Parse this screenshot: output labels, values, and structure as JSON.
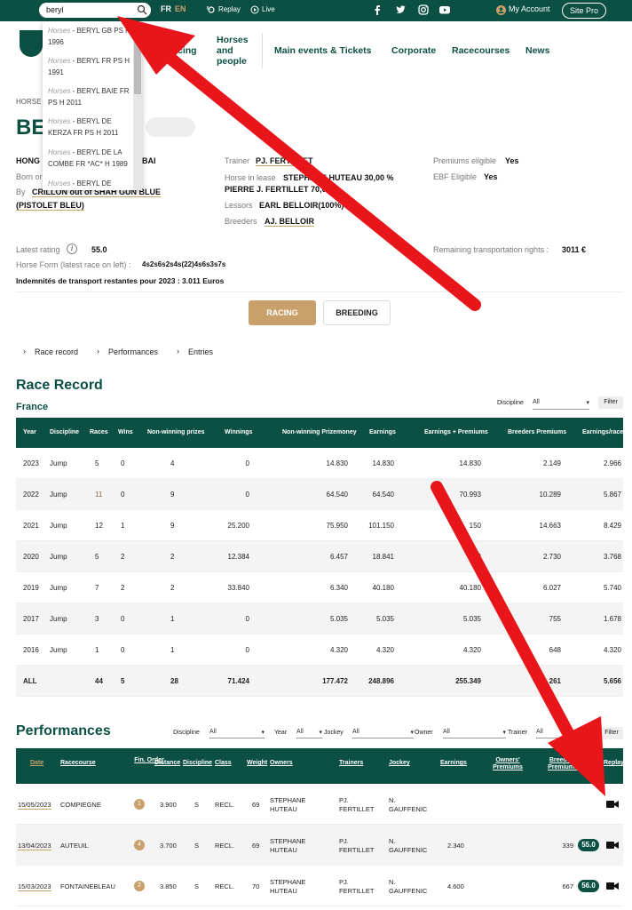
{
  "topbar": {
    "search_value": "beryl",
    "lang_fr": "FR",
    "lang_en": "EN",
    "replay": "Replay",
    "live": "Live",
    "account": "My Account",
    "site_pro": "Site Pro"
  },
  "nav": {
    "racing": "cing",
    "horses_people": [
      "Horses",
      "and",
      "people"
    ],
    "main_events": "Main events & Tickets",
    "corporate": "Corporate",
    "racecourses": "Racecourses",
    "news": "News"
  },
  "dropdown": [
    {
      "prefix": "Horses",
      "text": " - BERYL GB PS H 1996"
    },
    {
      "prefix": "Horses",
      "text": " - BERYL FR PS H 1991"
    },
    {
      "prefix": "Horses",
      "text": " - BERYL BAIE FR PS H 2011"
    },
    {
      "prefix": "Horses",
      "text": " - BERYL DE KERZA FR PS H 2011"
    },
    {
      "prefix": "Horses",
      "text": " - BERYL DE LA COMBE FR *AC* H 1989"
    },
    {
      "prefix": "Horses",
      "text": " - BERYL DE"
    }
  ],
  "horse": {
    "breadcrumb": "HORSE I",
    "name": "BE",
    "origin_partial": "HONG",
    "origin_tail": "BAI",
    "born_partial": "Born or",
    "by_label": "By",
    "sire": "CRILLON out of SHAH GUN BLUE",
    "damsire": "(PISTOLET BLEU)",
    "trainer_label": "Trainer",
    "trainer": "PJ. FERTILLET",
    "lease_label": "Horse in lease",
    "lease_value": "STEPHANE HUTEAU 30,00 %",
    "lease_value2": "PIERRE J. FERTILLET 70,00 %",
    "lessors_label": "Lessors",
    "lessors": "EARL BELLOIR(100%)",
    "breeders_label": "Breeders",
    "breeders": "AJ. BELLOIR",
    "premiums_label": "Premiums eligible",
    "premiums": "Yes",
    "ebf_label": "EBF Eligible",
    "ebf": "Yes",
    "latest_rating_label": "Latest rating",
    "latest_rating": "55.0",
    "form_label": "Horse Form (latest race on left) :",
    "form": "4s2s6s2s4s(22)4s6s3s7s",
    "transport_label": "Remaining transportation rights :",
    "transport": "3011 €",
    "indemnites": "Indemnités de transport restantes pour 2023 : 3.011 Euros"
  },
  "buttons": {
    "racing": "RACING",
    "breeding": "BREEDING"
  },
  "tabs": [
    "Race record",
    "Performances",
    "Entries"
  ],
  "race_record": {
    "title": "Race Record",
    "country": "France",
    "discipline_label": "Discipline",
    "discipline_value": "All",
    "filter": "Filter",
    "headers": [
      "Year",
      "Discipline",
      "Races",
      "Wins",
      "Non-winning prizes",
      "Winnings",
      "Non-winning Prizemoney",
      "Earnings",
      "Earnings + Premiums",
      "Breeders Premiums",
      "Earnings/race"
    ],
    "rows": [
      [
        "2023",
        "Jump",
        "5",
        "0",
        "4",
        "0",
        "14.830",
        "14.830",
        "14.830",
        "2.149",
        "2.966"
      ],
      [
        "2022",
        "Jump",
        "11",
        "0",
        "9",
        "0",
        "64.540",
        "64.540",
        "70.993",
        "10.289",
        "5.867"
      ],
      [
        "2021",
        "Jump",
        "12",
        "1",
        "9",
        "25.200",
        "75.950",
        "101.150",
        "150",
        "14.663",
        "8.429"
      ],
      [
        "2020",
        "Jump",
        "5",
        "2",
        "2",
        "12.384",
        "6.457",
        "18.841",
        "18",
        "2.730",
        "3.768"
      ],
      [
        "2019",
        "Jump",
        "7",
        "2",
        "2",
        "33.840",
        "6.340",
        "40.180",
        "40.180",
        "6.027",
        "5.740"
      ],
      [
        "2017",
        "Jump",
        "3",
        "0",
        "1",
        "0",
        "5.035",
        "5.035",
        "5.035",
        "755",
        "1.678"
      ],
      [
        "2016",
        "Jump",
        "1",
        "0",
        "1",
        "0",
        "4.320",
        "4.320",
        "4.320",
        "648",
        "4.320"
      ],
      [
        "ALL",
        "",
        "44",
        "5",
        "28",
        "71.424",
        "177.472",
        "248.896",
        "255.349",
        "261",
        "5.656"
      ]
    ]
  },
  "performances": {
    "title": "Performances",
    "filters": [
      {
        "label": "Discipline",
        "value": "All"
      },
      {
        "label": "Year",
        "value": "All"
      },
      {
        "label": "Jockey",
        "value": "All"
      },
      {
        "label": "Owner",
        "value": "All"
      },
      {
        "label": "Trainer",
        "value": "All"
      }
    ],
    "filter_button": "Filter",
    "headers": [
      "Date",
      "Racecourse",
      "Fin. Order",
      "Distance",
      "Discipline",
      "Class",
      "Weight",
      "Owners",
      "Trainers",
      "Jockey",
      "Earnings",
      "Owners' Premiums",
      "Breeders Premiums",
      "Replay"
    ],
    "rows": [
      {
        "date": "15/05/2023",
        "course": "COMPIEGNE",
        "order": "1",
        "distance": "3.900",
        "disc": "S",
        "class": "RECL.",
        "weight": "69",
        "owner1": "STEPHANE",
        "owner2": "HUTEAU",
        "trainer1": "PJ.",
        "trainer2": "FERTILLET",
        "jockey1": "N.",
        "jockey2": "GAUFFENIC",
        "earnings": "",
        "breeders": "",
        "rating": ""
      },
      {
        "date": "13/04/2023",
        "course": "AUTEUIL",
        "order": "4",
        "distance": "3.700",
        "disc": "S",
        "class": "RECL.",
        "weight": "69",
        "owner1": "STEPHANE",
        "owner2": "HUTEAU",
        "trainer1": "PJ.",
        "trainer2": "FERTILLET",
        "jockey1": "N.",
        "jockey2": "GAUFFENIC",
        "earnings": "2.340",
        "breeders": "339",
        "rating": "55.0"
      },
      {
        "date": "15/03/2023",
        "course": "FONTAINEBLEAU",
        "order": "2",
        "distance": "3.850",
        "disc": "S",
        "class": "RECL.",
        "weight": "70",
        "owner1": "STEPHANE",
        "owner2": "HUTEAU",
        "trainer1": "PJ.",
        "trainer2": "FERTILLET",
        "jockey1": "N.",
        "jockey2": "GAUFFENIC",
        "earnings": "4.600",
        "breeders": "667",
        "rating": "56.0"
      }
    ]
  },
  "colors": {
    "brand": "#0c5044",
    "accent": "#c7a06b",
    "arrow": "#e8161b"
  }
}
